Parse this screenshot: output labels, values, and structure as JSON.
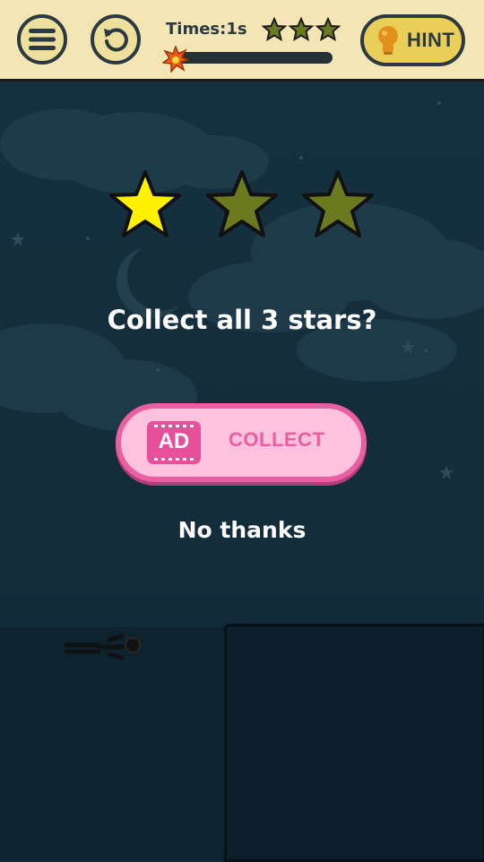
{
  "topbar": {
    "menu_icon": "menu-icon",
    "restart_icon": "restart-icon",
    "timer_label": "Times:1s",
    "progress": 0.04,
    "stars_total": 3,
    "hint_label": "HINT",
    "hint_icon": "lightbulb-icon"
  },
  "dialog": {
    "stars_filled": 1,
    "stars_total": 3,
    "prompt": "Collect all 3 stars?",
    "ad_badge": "AD",
    "collect_label": "COLLECT",
    "no_thanks_label": "No thanks"
  },
  "colors": {
    "bar_background": "#f4e6b4",
    "scene_background": "#1a3848",
    "star_filled": "#fff200",
    "star_empty": "#6b7a1e",
    "collect_button": "#ffc2de",
    "collect_accent": "#ea5fa1"
  }
}
